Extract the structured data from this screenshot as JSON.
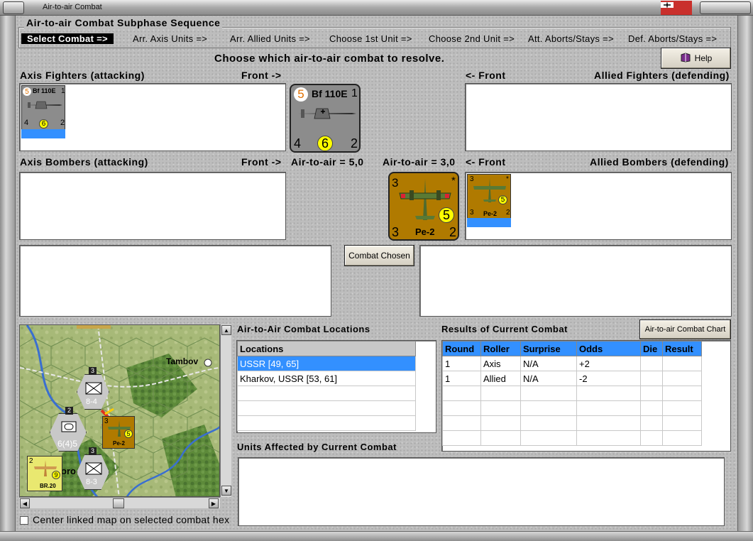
{
  "window": {
    "title": "Air-to-air Combat"
  },
  "sequence": {
    "title": "Air-to-air Combat Subphase Sequence",
    "steps": [
      "Select Combat =>",
      "Arr. Axis Units =>",
      "Arr. Allied Units =>",
      "Choose 1st Unit =>",
      "Choose 2nd Unit =>",
      "Att. Aborts/Stays =>",
      "Def. Aborts/Stays =>"
    ]
  },
  "instruction": "Choose which air-to-air combat to resolve.",
  "help_label": "Help",
  "labels": {
    "axis_fighters": "Axis Fighters (attacking)",
    "front_right": "Front ->",
    "front_left": "<- Front",
    "allied_fighters": "Allied Fighters (defending)",
    "axis_bombers": "Axis Bombers (attacking)",
    "front_right_2": "Front ->",
    "axis_air": "Air-to-air = 5,0",
    "allied_air": "Air-to-air = 3,0",
    "front_left_2": "<- Front",
    "allied_bombers": "Allied Bombers (defending)",
    "combat_locations": "Air-to-Air Combat Locations",
    "results": "Results of Current Combat",
    "units_affected": "Units Affected by Current Combat",
    "center_map": "Center linked map on selected combat hex"
  },
  "buttons": {
    "combat_chosen": "Combat Chosen",
    "chart": "Air-to-air Combat Chart"
  },
  "axis_counter": {
    "name": "Bf 110E",
    "top_left": "5",
    "top_right": "1",
    "bottom_left": "4",
    "bottom_mid": "6",
    "bottom_right": "2"
  },
  "allied_counter": {
    "name": "Pe-2",
    "top_left": "3",
    "top_right": "*",
    "bottom_left": "3",
    "mid": "5",
    "bottom_right": "2"
  },
  "locations": {
    "header": "Locations",
    "rows": [
      "USSR [49, 65]",
      "Kharkov, USSR [53, 61]"
    ]
  },
  "results_table": {
    "columns": [
      "Round",
      "Roller",
      "Surprise",
      "Odds",
      "Die",
      "Result"
    ],
    "rows": [
      [
        "1",
        "Axis",
        "N/A",
        "+2",
        "",
        ""
      ],
      [
        "1",
        "Allied",
        "N/A",
        "-2",
        "",
        ""
      ]
    ]
  },
  "map": {
    "city": "Tambov",
    "city2": "oro",
    "units": [
      {
        "type": "xxx",
        "value": "8-4",
        "stack": "3"
      },
      {
        "type": "xxxxx",
        "value": "6(4)5",
        "stack": "2"
      },
      {
        "type": "xxx",
        "value": "8-3",
        "stack": "3"
      },
      {
        "type": "air",
        "name": "BR.20",
        "value": "9",
        "corner": "2"
      },
      {
        "type": "air",
        "name": "Pe-2",
        "value": "5",
        "corner": "3"
      }
    ]
  },
  "colors": {
    "counter_axis": "#8c8c8c",
    "counter_allied": "#b07a00",
    "selection": "#3390ff",
    "circle": "#ffff00"
  }
}
